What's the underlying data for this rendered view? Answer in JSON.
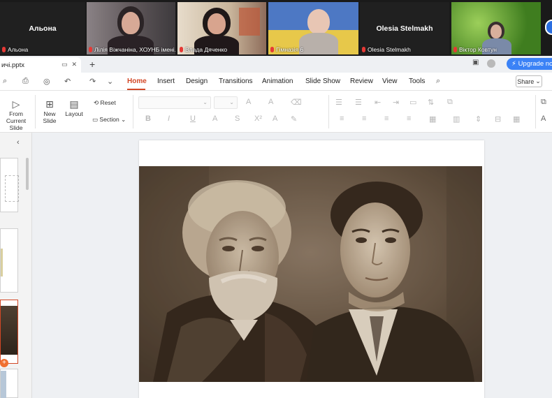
{
  "meeting": {
    "participants": [
      {
        "display": "Альона",
        "label": "Альона",
        "video": false
      },
      {
        "label": "Лілія Віжчаніна, ХОУНБ імені...",
        "video": true
      },
      {
        "label": "Влада Дяченко",
        "video": true
      },
      {
        "label": "Гімназія 6",
        "video": true
      },
      {
        "display": "Olesia Stelmakh",
        "label": "Olesia Stelmakh",
        "video": false
      },
      {
        "label": "Віктор Ковтун",
        "video": true
      }
    ]
  },
  "document": {
    "filename": "ичі.pptx",
    "upgrade_label": "Upgrade no",
    "share_label": "Share"
  },
  "menu": {
    "tabs": [
      "Home",
      "Insert",
      "Design",
      "Transitions",
      "Animation",
      "Slide Show",
      "Review",
      "View",
      "Tools"
    ],
    "active": "Home"
  },
  "ribbon": {
    "from_current_1": "From Current",
    "from_current_2": "Slide",
    "new_slide_1": "New",
    "new_slide_2": "Slide",
    "layout": "Layout",
    "reset": "Reset",
    "section": "Section"
  },
  "colors": {
    "accent": "#d24726",
    "upgrade": "#3b82f6",
    "workspace": "#eef0f3"
  }
}
